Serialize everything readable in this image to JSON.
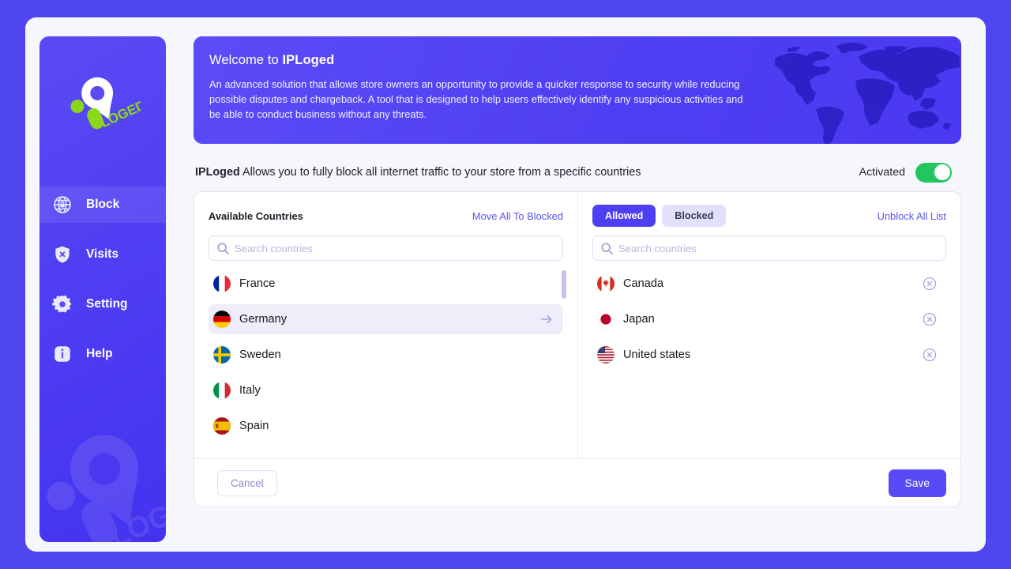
{
  "theme": {
    "page_background": "#4f46f0",
    "app_background": "#f6f7fc",
    "accent": "#4f3ff2",
    "accent_soft": "#e2e1fb",
    "toggle_on": "#22c55e",
    "link": "#5b54ef",
    "logo_green": "#8bd818"
  },
  "sidebar": {
    "logo_name": "iploged-logo",
    "logo_word": "LOGED",
    "items": [
      {
        "id": "block",
        "label": "Block",
        "icon": "globe-lock-icon",
        "active": true
      },
      {
        "id": "visits",
        "label": "Visits",
        "icon": "shield-x-icon",
        "active": false
      },
      {
        "id": "setting",
        "label": "Setting",
        "icon": "gear-icon",
        "active": false
      },
      {
        "id": "help",
        "label": "Help",
        "icon": "info-square-icon",
        "active": false
      }
    ]
  },
  "banner": {
    "title_prefix": "Welcome to ",
    "title_brand": "IPLoged",
    "description": "An advanced solution that allows store owners an opportunity to provide a quicker response to security while reducing possible disputes and chargeback. A tool that is designed to help users effectively identify any suspicious activities and be able to conduct business without any threats.",
    "map_icon": "world-map-icon"
  },
  "subheader": {
    "brand": "IPLoged",
    "text": " Allows you to fully block all internet traffic to your store from a specific countries",
    "activation_label": "Activated",
    "activation_on": true
  },
  "available_panel": {
    "title": "Available Countries",
    "move_all_label": "Move All To Blocked",
    "search": {
      "value": "",
      "placeholder": "Search countries"
    },
    "countries": [
      {
        "name": "France",
        "flag": "flag-france",
        "hover": false
      },
      {
        "name": "Germany",
        "flag": "flag-germany",
        "hover": true
      },
      {
        "name": "Sweden",
        "flag": "flag-sweden",
        "hover": false
      },
      {
        "name": "Italy",
        "flag": "flag-italy",
        "hover": false
      },
      {
        "name": "Spain",
        "flag": "flag-spain",
        "hover": false
      }
    ],
    "row_action_icon": "arrow-right-icon",
    "scrollbar": true
  },
  "selected_panel": {
    "tabs": [
      {
        "label": "Allowed",
        "selected": true
      },
      {
        "label": "Blocked",
        "selected": false
      }
    ],
    "unblock_all_label": "Unblock All List",
    "search": {
      "value": "",
      "placeholder": "Search countries"
    },
    "countries": [
      {
        "name": "Canada",
        "flag": "flag-canada"
      },
      {
        "name": "Japan",
        "flag": "flag-japan"
      },
      {
        "name": "United states",
        "flag": "flag-usa"
      }
    ],
    "row_action_icon": "remove-circle-icon"
  },
  "footer": {
    "cancel_label": "Cancel",
    "save_label": "Save"
  }
}
